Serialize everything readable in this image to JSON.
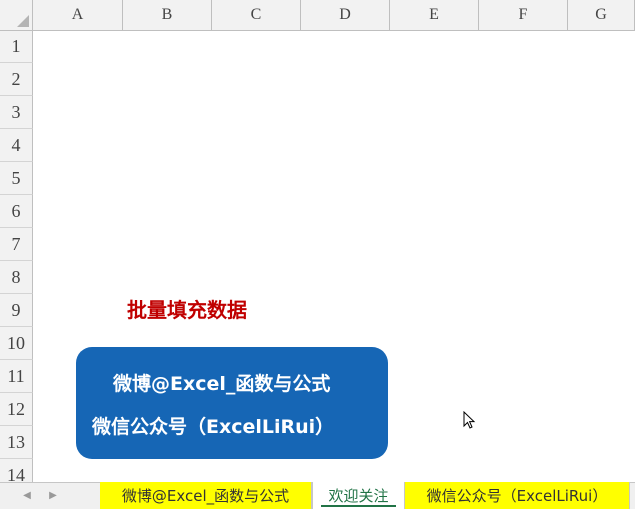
{
  "columns": [
    "A",
    "B",
    "C",
    "D",
    "E",
    "F",
    "G"
  ],
  "rows": [
    "1",
    "2",
    "3",
    "4",
    "5",
    "6",
    "7",
    "8",
    "9",
    "10",
    "11",
    "12",
    "13",
    "14"
  ],
  "content": {
    "title": "批量填充数据",
    "card_line1": "微博@Excel_函数与公式",
    "card_line2": "微信公众号（ExcelLiRui）"
  },
  "sheet_tabs": [
    {
      "label": "微博@Excel_函数与公式"
    },
    {
      "label": "欢迎关注"
    },
    {
      "label": "微信公众号（ExcelLiRui）"
    }
  ],
  "colors": {
    "title": "#c00000",
    "card_bg": "#1666b5",
    "tab_highlight": "#ffff00",
    "active_tab_text": "#217346"
  },
  "icons": {
    "scroll_left": "triangle-left-icon",
    "scroll_right": "triangle-right-icon",
    "cursor": "mouse-pointer-icon"
  }
}
